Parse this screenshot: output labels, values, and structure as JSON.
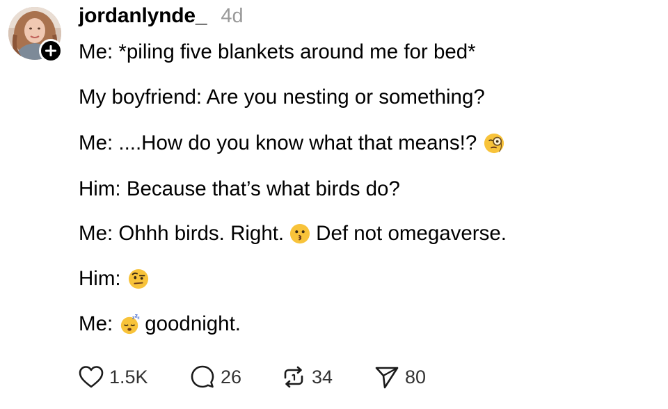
{
  "post": {
    "username": "jordanlynde_",
    "timestamp": "4d",
    "lines": {
      "l1": "Me: *piling five blankets around me for bed*",
      "l2": "My boyfriend: Are you nesting or something?",
      "l3": "Me: ....How do you know what that means!?",
      "l4": "Him: Because that’s what birds do?",
      "l5a": "Me: Ohhh birds. Right.",
      "l5b": "Def not omegaverse.",
      "l6": "Him:",
      "l7a": "Me:",
      "l7b": "goodnight."
    },
    "emojis": {
      "l3": "face-with-monocle-emoji",
      "l5": "kissing-face-emoji",
      "l6": "face-with-raised-eyebrow-emoji",
      "l7": "sleeping-face-emoji"
    }
  },
  "actions": {
    "like": {
      "icon": "heart-icon",
      "count": "1.5K"
    },
    "reply": {
      "icon": "comment-bubble-icon",
      "count": "26"
    },
    "repost": {
      "icon": "repost-icon",
      "count": "34"
    },
    "share": {
      "icon": "send-icon",
      "count": "80"
    }
  },
  "colors": {
    "text": "#000000",
    "muted": "#9a9a9a",
    "count": "#333333",
    "emoji_yellow": "#f8c33a"
  }
}
